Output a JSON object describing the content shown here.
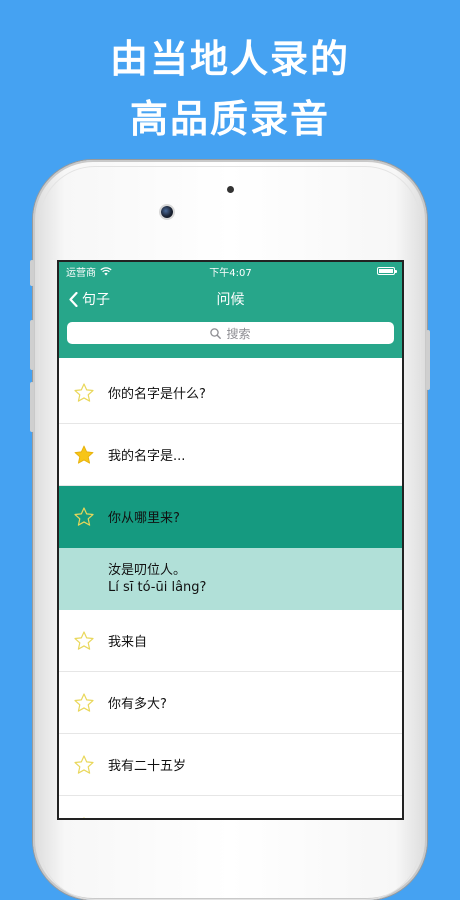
{
  "promo": {
    "headline_line1": "由当地人录的",
    "headline_line2": "高品质录音"
  },
  "status_bar": {
    "carrier": "运营商",
    "time": "下午4:07"
  },
  "nav": {
    "back_label": "句子",
    "title": "问候"
  },
  "search": {
    "placeholder": "搜索"
  },
  "list": {
    "items": [
      {
        "text": "你的名字是什么?",
        "favorite": false
      },
      {
        "text": "我的名字是...",
        "favorite": true
      },
      {
        "text": "你从哪里来?",
        "favorite": false,
        "selected": true
      },
      {
        "translation": "汝是叨位人。",
        "romanization": "Lí sī tó-ūi lâng?"
      },
      {
        "text": "我来自",
        "favorite": false
      },
      {
        "text": "你有多大?",
        "favorite": false
      },
      {
        "text": "我有二十五岁",
        "favorite": false
      }
    ]
  },
  "colors": {
    "background": "#45a2f2",
    "brand_green": "#27a68a",
    "selected_row": "#159a80",
    "detail_row": "#b1e0d8",
    "star_filled": "#f7c518",
    "star_outline": "#e9d75a"
  }
}
